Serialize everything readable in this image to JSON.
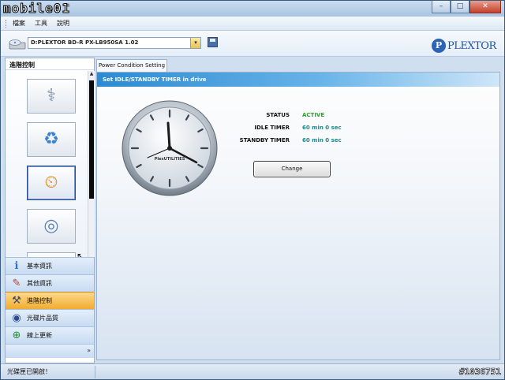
{
  "window": {
    "logo_text": "mobile01",
    "logo_mark": "®",
    "buttons": {
      "minimize": "–",
      "maximize": "□",
      "close": "✕"
    }
  },
  "menu": {
    "items": [
      {
        "label": "檔案"
      },
      {
        "label": "工具"
      },
      {
        "label": "說明"
      }
    ]
  },
  "drivebar": {
    "drive_label": "D:PLEXTOR BD-R  PX-LB950SA 1.02",
    "dropdown_arrow": "▾",
    "brand": "PLEXTOR",
    "brand_mark": "P"
  },
  "sidebar": {
    "header": "進階控制",
    "tools": [
      {
        "icon": "stethoscope-drive-icon",
        "glyph": "⚕"
      },
      {
        "icon": "recycle-bin-icon",
        "glyph": "♻"
      },
      {
        "icon": "drive-clock-icon",
        "glyph": "⏲"
      },
      {
        "icon": "disc-gear-icon",
        "glyph": "◎"
      }
    ],
    "scroll_up": "▲",
    "cursor": "↖",
    "nav": [
      {
        "label": "基本資訊",
        "icon": "info-icon",
        "glyph": "ℹ",
        "active": false
      },
      {
        "label": "其他資訊",
        "icon": "notes-icon",
        "glyph": "✎",
        "active": false
      },
      {
        "label": "進階控制",
        "icon": "tools-icon",
        "glyph": "⚒",
        "active": true
      },
      {
        "label": "光碟片品質",
        "icon": "disc-quality-icon",
        "glyph": "◉",
        "active": false
      },
      {
        "label": "線上更新",
        "icon": "globe-update-icon",
        "glyph": "⊕",
        "active": false
      }
    ],
    "footer_chevron": "»"
  },
  "main": {
    "tab": "Power Condition Setting",
    "section_title": "Set IDLE/STANDBY TIMER in drive",
    "clock_brand": "PlexUTILITIES",
    "status": {
      "label": "STATUS",
      "value": "ACTIVE",
      "color": "#2aa22a"
    },
    "idle_timer": {
      "label": "IDLE TIMER",
      "value": "60 min 0 sec"
    },
    "standby_timer": {
      "label": "STANDBY TIMER",
      "value": "60 min 0 sec"
    },
    "change_button": "Change"
  },
  "statusbar": {
    "text": "光碟匣已開啟！",
    "watermark": "#1036751"
  }
}
